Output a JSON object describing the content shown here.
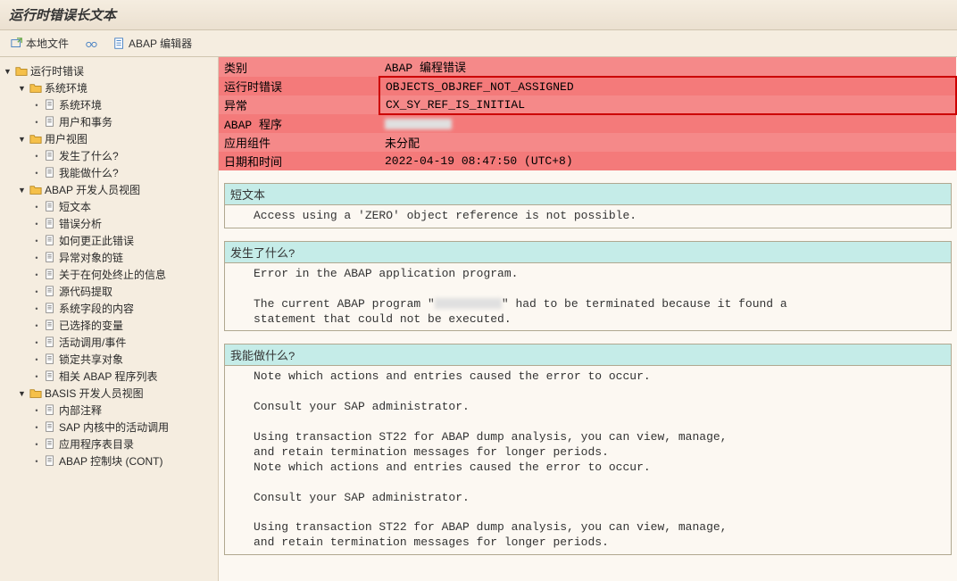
{
  "title": "运行时错误长文本",
  "toolbar": {
    "local_file": "本地文件",
    "abap_editor": "ABAP 编辑器"
  },
  "tree": {
    "root": "运行时错误",
    "n1": "系统环境",
    "n1_1": "系统环境",
    "n1_2": "用户和事务",
    "n2": "用户视图",
    "n2_1": "发生了什么?",
    "n2_2": "我能做什么?",
    "n3": "ABAP 开发人员视图",
    "n3_1": "短文本",
    "n3_2": "错误分析",
    "n3_3": "如何更正此错误",
    "n3_4": "异常对象的链",
    "n3_5": "关于在何处终止的信息",
    "n3_6": "源代码提取",
    "n3_7": "系统字段的内容",
    "n3_8": "已选择的变量",
    "n3_9": "活动调用/事件",
    "n3_10": "锁定共享对象",
    "n3_11": "相关 ABAP 程序列表",
    "n4": "BASIS 开发人员视图",
    "n4_1": "内部注释",
    "n4_2": "SAP 内核中的活动调用",
    "n4_3": "应用程序表目录",
    "n4_4": "ABAP 控制块 (CONT)"
  },
  "info": {
    "cat_label": "类别",
    "cat_val": "ABAP 编程错误",
    "rt_label": "运行时错误",
    "rt_val": "OBJECTS_OBJREF_NOT_ASSIGNED",
    "ex_label": "异常",
    "ex_val": "CX_SY_REF_IS_INITIAL",
    "prog_label": "ABAP 程序",
    "comp_label": "应用组件",
    "comp_val": "未分配",
    "dt_label": "日期和时间",
    "dt_val": "2022-04-19 08:47:50 (UTC+8)"
  },
  "sections": {
    "short_title": "短文本",
    "short_body": "Access using a 'ZERO' object reference is not possible.",
    "what_title": "发生了什么?",
    "what_body1": "Error in the ABAP application program.",
    "what_body2a": "The current ABAP program \"",
    "what_body2b": "\" had to be terminated because it found a",
    "what_body3": "statement that could not be executed.",
    "can_title": "我能做什么?",
    "can_1": "Note which actions and entries caused the error to occur.",
    "can_2": "Consult your SAP administrator.",
    "can_3": "Using transaction ST22 for ABAP dump analysis, you can view, manage,",
    "can_4": "and retain termination messages for longer periods.",
    "can_5": "Note which actions and entries caused the error to occur.",
    "can_6": "Consult your SAP administrator.",
    "can_7": "Using transaction ST22 for ABAP dump analysis, you can view, manage,",
    "can_8": "and retain termination messages for longer periods."
  }
}
